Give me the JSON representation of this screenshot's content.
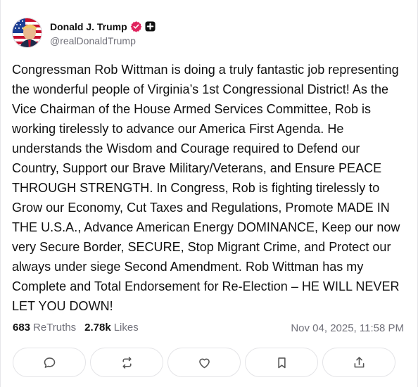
{
  "post": {
    "author": {
      "display_name": "Donald J. Trump",
      "handle": "@realDonaldTrump",
      "avatar_icon": "avatar-flag-portrait",
      "verified_icon": "verified-badge-icon",
      "badge_icon": "plus-badge-icon"
    },
    "text": "Congressman Rob Wittman is doing a truly fantastic job representing the wonderful people of Virginia’s 1st Congressional District!   As the Vice Chairman of the House Armed Services Committee, Rob is working tirelessly to advance our America First Agenda. He understands the Wisdom and Courage required to Defend our Country, Support our Brave Military/Veterans, and Ensure PEACE THROUGH STRENGTH. In Congress, Rob is fighting tirelessly to Grow our Economy, Cut Taxes and Regulations, Promote MADE IN THE U.S.A., Advance American Energy DOMINANCE, Keep our now very Secure Border, SECURE, Stop Migrant Crime, and Protect our always under siege Second Amendment.   Rob Wittman has my Complete and Total Endorsement for Re-Election – HE WILL NEVER LET YOU DOWN!",
    "stats": {
      "retruths_count": "683",
      "retruths_label": "ReTruths",
      "likes_count": "2.78k",
      "likes_label": "Likes"
    },
    "timestamp": "Nov 04, 2025, 11:58 PM",
    "actions": [
      {
        "name": "reply",
        "icon": "comment-icon"
      },
      {
        "name": "retruth",
        "icon": "repost-icon"
      },
      {
        "name": "like",
        "icon": "heart-icon"
      },
      {
        "name": "bookmark",
        "icon": "bookmark-icon"
      },
      {
        "name": "share",
        "icon": "share-icon"
      }
    ]
  },
  "colors": {
    "text": "#111111",
    "muted": "#71717a",
    "verified": "#e0245e",
    "border": "#e4e4e7"
  }
}
